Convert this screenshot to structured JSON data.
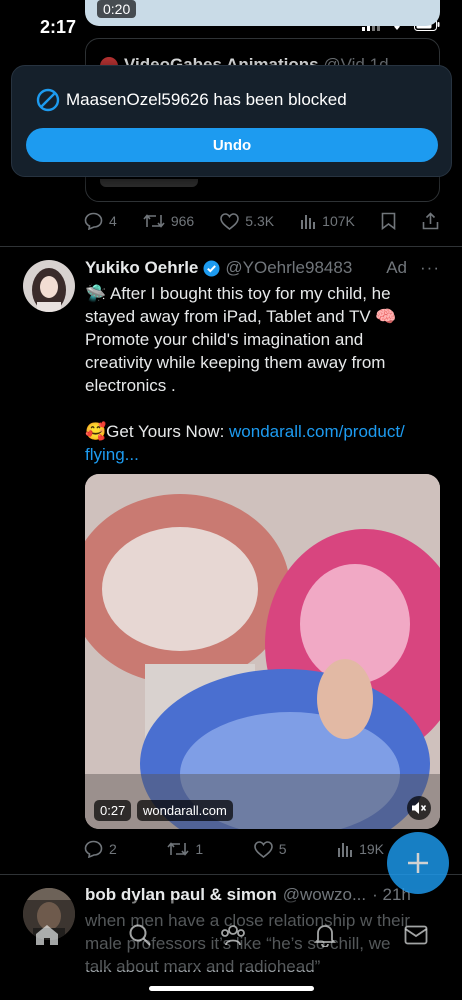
{
  "status_bar": {
    "time": "2:17"
  },
  "top_tweet": {
    "media_duration": "0:20",
    "quote_name": "VideoGabes Animations",
    "quote_handle": "@Vid",
    "quote_time": "1d",
    "replies": "4",
    "reposts": "966",
    "likes": "5.3K",
    "views": "107K"
  },
  "toast": {
    "message": "MaasenOzel59626 has been blocked",
    "undo_label": "Undo"
  },
  "ad_tweet": {
    "name": "Yukiko Oehrle",
    "handle": "@YOehrle98483",
    "ad_label": "Ad",
    "text_line1": "🛸 After I bought this toy for my child, he",
    "text_line2": "stayed away from iPad, Tablet and TV 🧠",
    "text_line3": "Promote your child's imagination and",
    "text_line4": "creativity while keeping them away from",
    "text_line5": "electronics .",
    "cta_prefix": "🥰Get Yours Now: ",
    "cta_link_1": "wondarall.com/product/",
    "cta_link_2": "flying...",
    "video_duration": "0:27",
    "video_domain": "wondarall.com",
    "replies": "2",
    "reposts": "1",
    "likes": "5",
    "views": "19K"
  },
  "next_tweet": {
    "name": "bob dylan paul & simon",
    "handle": "@wowzo...",
    "time": "· 21h",
    "line1": "when men have a close relationship w their",
    "line2": "male professors it’s like “he’s so chill, we",
    "line3": "talk about marx and radiohead”"
  },
  "colors": {
    "accent": "#1d9bf0",
    "background": "#000000",
    "toast_bg": "#15202b",
    "muted": "#71767b"
  },
  "icons": [
    "signal-icon",
    "wifi-icon",
    "battery-icon",
    "blocked-icon",
    "reply-icon",
    "repost-icon",
    "like-icon",
    "views-icon",
    "bookmark-icon",
    "share-icon",
    "verified-badge-icon",
    "more-icon",
    "mute-icon",
    "compose-icon",
    "home-icon",
    "search-icon",
    "communities-icon",
    "notifications-icon",
    "messages-icon"
  ]
}
